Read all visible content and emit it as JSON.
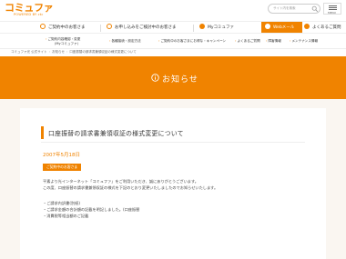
{
  "header": {
    "logo_text": "コミュファ",
    "logo_sub": "POWERED BY ctc",
    "search_placeholder": "サイト内を検索",
    "menu_label": "MENU"
  },
  "mainnav": {
    "items": [
      {
        "label": "ご契約中のお客さま"
      },
      {
        "label": "お申し込みをご検討中のお客さま"
      },
      {
        "label": "Myコミュファ"
      },
      {
        "label": "Webメール"
      },
      {
        "label": "よくあるご質問"
      }
    ]
  },
  "subnav": {
    "items": [
      {
        "line1": "ご契約内容確認・変更",
        "line2": "(Myコミュファ)"
      },
      {
        "line1": "各種接続・設定方法",
        "line2": ""
      },
      {
        "line1": "ご契約中のお客さまにお得な・キャンペーン",
        "line2": ""
      },
      {
        "line1": "よくあるご質問",
        "line2": ""
      },
      {
        "line1": "障害情報",
        "line2": ""
      },
      {
        "line1": "メンテナンス情報",
        "line2": ""
      }
    ]
  },
  "breadcrumb": {
    "items": [
      "コミュファ光 公式サイト",
      "お知らせ",
      "口座振替の請求書兼領収証の様式変更について"
    ]
  },
  "banner": {
    "title": "お知らせ"
  },
  "article": {
    "title": "口座振替の請求書兼領収証の様式変更について",
    "date": "2007年5月18日",
    "tag": "ご契約中のお客さま",
    "paragraphs": [
      "平素より光インターネット「コミュファ」をご利用いただき、誠にありがとうございます。",
      "この度、口座振替の請求書兼領収証の様式を下記のとおり変更いたしましたのでお知らせいたします。",
      "",
      "・ご請求内訳書(別紙)",
      "・ご請求金額の合計額の記載を明記しました。(口座振替",
      "・消費税等相当額のご記載"
    ]
  },
  "colors": {
    "brand_orange": "#f08300",
    "content_bg": "#faf6f1"
  }
}
